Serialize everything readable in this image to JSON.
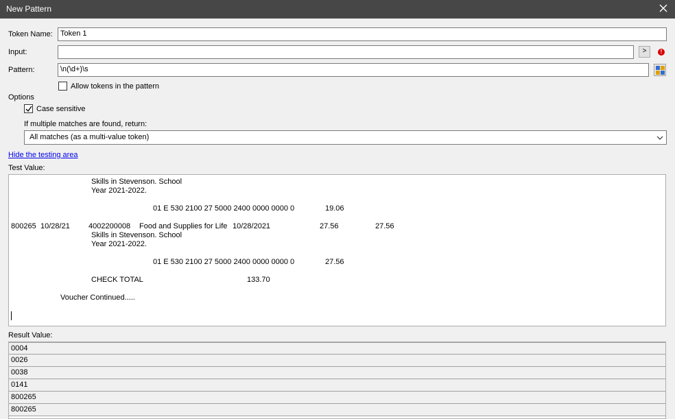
{
  "window": {
    "title": "New Pattern"
  },
  "form": {
    "token_name_label": "Token Name:",
    "token_name_value": "Token 1",
    "input_label": "Input:",
    "input_value": "",
    "input_button": ">",
    "input_error": "!",
    "pattern_label": "Pattern:",
    "pattern_value": "\\n(\\d+)\\s",
    "allow_tokens_label": "Allow tokens in the pattern",
    "allow_tokens_checked": false
  },
  "options": {
    "heading": "Options",
    "case_sensitive_label": "Case sensitive",
    "case_sensitive_checked": true,
    "multiple_matches_label": "If multiple matches are found, return:",
    "multiple_matches_selected": "All matches (as a multi-value token)"
  },
  "testing": {
    "hide_link": "Hide the testing area",
    "test_value_label": "Test Value:",
    "lines": [
      "Skills in Stevenson. School",
      "Year 2021-2022.",
      "01 E 530 2100 27 5000 2400 0000 0000 0",
      "19.06",
      "800265",
      "10/28/21",
      "4002200008",
      "Food and Supplies for Life",
      "10/28/2021",
      "27.56",
      "27.56",
      "Skills in Stevenson. School",
      "Year 2021-2022.",
      "01 E 530 2100 27 5000 2400 0000 0000 0",
      "27.56",
      "CHECK TOTAL",
      "133.70",
      "Voucher Continued....."
    ],
    "result_value_label": "Result Value:",
    "results": [
      "0004",
      "0026",
      "0038",
      "0141",
      "800265",
      "800265"
    ]
  }
}
